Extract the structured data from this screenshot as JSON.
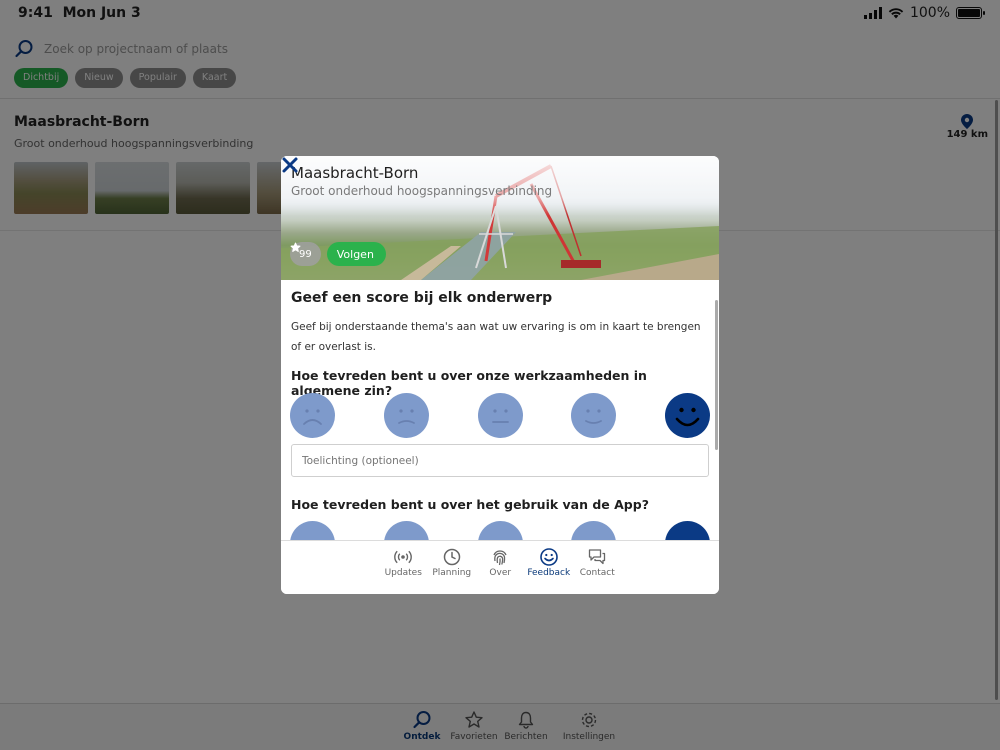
{
  "status_bar": {
    "time": "9:41",
    "date": "Mon Jun 3",
    "battery": "100%",
    "battery_level": 1.0
  },
  "search": {
    "placeholder": "Zoek op projectnaam of plaats",
    "icon": "search-icon"
  },
  "filters": [
    {
      "label": "Dichtbij",
      "active": true
    },
    {
      "label": "Nieuw",
      "active": false
    },
    {
      "label": "Populair",
      "active": false
    },
    {
      "label": "Kaart",
      "active": false
    }
  ],
  "project": {
    "title": "Maasbracht-Born",
    "subtitle": "Groot onderhoud hoogspanningsverbinding",
    "distance": "149 km"
  },
  "modal": {
    "title": "Maasbracht-Born",
    "subtitle": "Groot onderhoud hoogspanningsverbinding",
    "score": "99",
    "follow_label": "Volgen",
    "heading": "Geef een score bij elk onderwerp",
    "intro": "Geef bij onderstaande thema's aan wat uw ervaring is om in kaart te brengen of er overlast is.",
    "question_1": "Hoe tevreden bent u over onze werkzaamheden in algemene zin?",
    "question_1_selected": 5,
    "comment_placeholder": "Toelichting (optioneel)",
    "question_2": "Hoe tevreden bent u over het gebruik van de App?",
    "question_2_selected": 5,
    "tabs": [
      {
        "label": "Updates",
        "icon": "broadcast-icon",
        "active": false
      },
      {
        "label": "Planning",
        "icon": "clock-icon",
        "active": false
      },
      {
        "label": "Over",
        "icon": "fingerprint-icon",
        "active": false
      },
      {
        "label": "Feedback",
        "icon": "smiley-icon",
        "active": true
      },
      {
        "label": "Contact",
        "icon": "chat-icon",
        "active": false
      }
    ]
  },
  "tabbar": [
    {
      "label": "Ontdek",
      "icon": "search-icon",
      "active": true
    },
    {
      "label": "Favorieten",
      "icon": "star-icon",
      "active": false
    },
    {
      "label": "Berichten",
      "icon": "bell-icon",
      "active": false
    },
    {
      "label": "Instellingen",
      "icon": "gear-icon",
      "active": false
    }
  ],
  "colors": {
    "brand": "#0b3a85",
    "accent_green": "#2bb24c",
    "smiley_inactive": "#7e9acb"
  }
}
